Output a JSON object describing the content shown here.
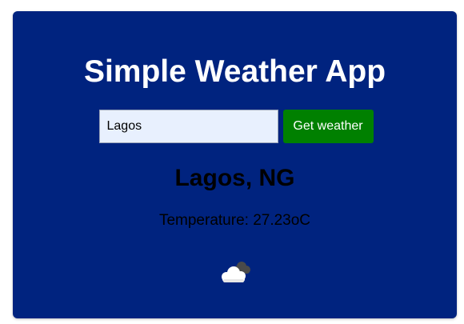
{
  "app": {
    "title": "Simple Weather App"
  },
  "search": {
    "value": "Lagos",
    "button_label": "Get weather"
  },
  "result": {
    "location": "Lagos, NG",
    "temperature_text": "Temperature: 27.23oC",
    "icon": "cloud-icon"
  },
  "colors": {
    "card_background": "#00237f",
    "button_background": "#008000",
    "input_background": "#e8f0fe"
  }
}
